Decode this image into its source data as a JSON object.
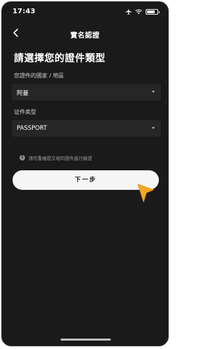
{
  "status_bar": {
    "time": "17:43"
  },
  "nav": {
    "title": "實名認證"
  },
  "page": {
    "heading": "請選擇您的證件類型"
  },
  "country_field": {
    "label": "您證件的國家 / 地區",
    "value": "阿曼"
  },
  "id_type_field": {
    "label": "证件类型",
    "value": "PASSPORT"
  },
  "notice": {
    "text": "請勿重複提交相同證件進行驗證"
  },
  "next_button": {
    "label": "下一步"
  },
  "colors": {
    "background": "#1a1a1a",
    "field": "#262626",
    "button": "#f5f5f5",
    "pointer": "#f5a623"
  },
  "icons": [
    "airplane-icon",
    "wifi-icon",
    "battery-icon",
    "back-arrow-icon",
    "chevron-down-icon",
    "info-icon",
    "pointer-icon"
  ]
}
